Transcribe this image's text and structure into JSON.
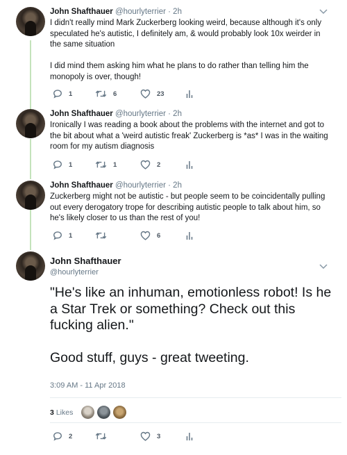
{
  "tweets": [
    {
      "name": "John Shafthauer",
      "meta": "@hourlyterrier · 2h",
      "paragraphs": [
        "I didn't really mind Mark Zuckerberg looking weird, because although it's only speculated he's autistic, I definitely am, & would probably look 10x weirder in the same situation",
        "I did mind them asking him what he plans to do rather than telling him the monopoly is over, though!"
      ],
      "replies": "1",
      "retweets": "6",
      "likes": "23"
    },
    {
      "name": "John Shafthauer",
      "meta": "@hourlyterrier · 2h",
      "paragraphs": [
        "Ironically I was reading a book about the problems with the internet and got to the bit about what a 'weird autistic freak' Zuckerberg is *as* I was in the waiting room for my autism diagnosis"
      ],
      "replies": "1",
      "retweets": "1",
      "likes": "2"
    },
    {
      "name": "John Shafthauer",
      "meta": "@hourlyterrier · 2h",
      "paragraphs": [
        "Zuckerberg might not be autistic - but people seem to be coincidentally pulling out every derogatory trope for describing autistic people to talk about him, so he's likely closer to us than the rest of you!"
      ],
      "replies": "1",
      "retweets": "",
      "likes": "6"
    }
  ],
  "main_tweet": {
    "name": "John Shafthauer",
    "handle": "@hourlyterrier",
    "paragraphs": [
      "\"He's like an inhuman, emotionless robot! Is he a Star Trek or something? Check out this fucking alien.\"",
      "Good stuff, guys - great tweeting."
    ],
    "timestamp": "3:09 AM - 11 Apr 2018",
    "likes_count": "3",
    "likes_label": "Likes",
    "replies": "2",
    "retweets": "",
    "likes": "3"
  },
  "colors": {
    "thread_line": "#c4e3bb",
    "icon": "#657786",
    "text": "#14171a"
  },
  "icons": [
    "reply-icon",
    "retweet-icon",
    "like-icon",
    "analytics-icon",
    "chevron-down-icon"
  ]
}
